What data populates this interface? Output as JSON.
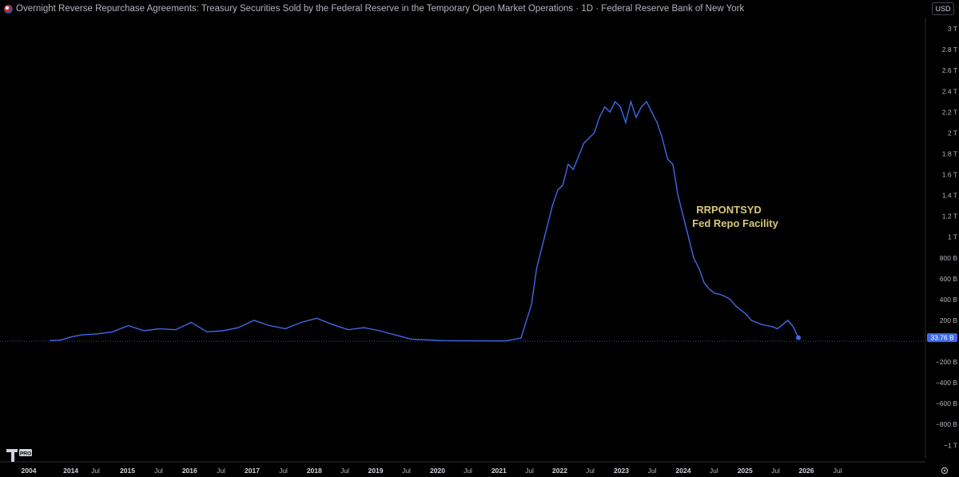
{
  "header": {
    "title": "Overnight Reverse Repurchase Agreements: Treasury Securities Sold by the Federal Reserve in the Temporary Open Market Operations · 1D · Federal Reserve Bank of New York",
    "currency_button": "USD"
  },
  "branding": {
    "logo_text": "PRO"
  },
  "colors": {
    "background": "#000000",
    "line": "#3f69ea",
    "annotation": "#d9c77a",
    "price_label_bg": "#3f69ea"
  },
  "chart_data": {
    "type": "line",
    "title": "Overnight Reverse Repurchase Agreements: Treasury Securities Sold by the Federal Reserve in the Temporary Open Market Operations · 1D · Federal Reserve Bank of New York",
    "series": [
      {
        "name": "RRPONTSYD",
        "x": [
          "2013-09",
          "2013-11",
          "2014-01",
          "2014-03",
          "2014-06",
          "2014-09",
          "2014-12",
          "2015-03",
          "2015-06",
          "2015-09",
          "2015-12",
          "2016-03",
          "2016-06",
          "2016-09",
          "2016-12",
          "2017-03",
          "2017-06",
          "2017-09",
          "2017-12",
          "2018-03",
          "2018-06",
          "2018-09",
          "2018-12",
          "2019-06",
          "2019-12",
          "2020-06",
          "2020-12",
          "2021-03",
          "2021-05",
          "2021-06",
          "2021-07",
          "2021-08",
          "2021-09",
          "2021-10",
          "2021-11",
          "2021-12",
          "2022-01",
          "2022-03",
          "2022-05",
          "2022-06",
          "2022-07",
          "2022-08",
          "2022-09",
          "2022-10",
          "2022-11",
          "2022-12",
          "2023-01",
          "2023-02",
          "2023-03",
          "2023-04",
          "2023-05",
          "2023-06",
          "2023-07",
          "2023-08",
          "2023-09",
          "2023-10",
          "2023-11",
          "2023-12",
          "2024-01",
          "2024-02",
          "2024-03",
          "2024-04",
          "2024-05",
          "2024-06",
          "2024-07",
          "2024-08",
          "2024-09",
          "2024-10",
          "2024-11",
          "2024-12",
          "2025-01",
          "2025-02",
          "2025-03",
          "2025-04",
          "2025-05",
          "2025-06",
          "2025-07",
          "2025-08"
        ],
        "values": [
          5,
          10,
          40,
          60,
          70,
          90,
          150,
          100,
          120,
          110,
          180,
          90,
          100,
          130,
          200,
          150,
          120,
          180,
          220,
          160,
          110,
          130,
          100,
          20,
          5,
          3,
          2,
          30,
          350,
          700,
          900,
          1100,
          1300,
          1450,
          1500,
          1700,
          1650,
          1900,
          2000,
          2150,
          2250,
          2200,
          2300,
          2250,
          2100,
          2300,
          2150,
          2250,
          2300,
          2200,
          2100,
          1950,
          1750,
          1700,
          1400,
          1200,
          1000,
          800,
          700,
          560,
          500,
          460,
          450,
          430,
          400,
          340,
          300,
          260,
          200,
          180,
          160,
          150,
          140,
          120,
          160,
          200,
          140,
          33.76
        ]
      }
    ],
    "y_ticks": [
      "3 T",
      "2.8 T",
      "2.6 T",
      "2.4 T",
      "2.2 T",
      "2 T",
      "1.8 T",
      "1.6 T",
      "1.4 T",
      "1.2 T",
      "1 T",
      "800 B",
      "600 B",
      "400 B",
      "200 B",
      "−200 B",
      "−400 B",
      "−600 B",
      "−800 B",
      "−1 T"
    ],
    "x_ticks": [
      "2004",
      "2014",
      "Jul",
      "2015",
      "Jul",
      "2016",
      "Jul",
      "2017",
      "Jul",
      "2018",
      "Jul",
      "2019",
      "Jul",
      "2020",
      "Jul",
      "2021",
      "Jul",
      "2022",
      "Jul",
      "2023",
      "Jul",
      "2024",
      "Jul",
      "2025",
      "Jul",
      "2026",
      "Jul"
    ],
    "x_year_ticks": [
      "2004",
      "2014",
      "2015",
      "2016",
      "2017",
      "2018",
      "2019",
      "2020",
      "2021",
      "2022",
      "2023",
      "2024",
      "2025",
      "2026"
    ],
    "ylim": [
      -1000,
      3000
    ],
    "unit": "billions USD",
    "last_value_label": "33.76 B",
    "annotations": [
      "RRPONTSYD",
      "Fed Repo Facility"
    ],
    "grid": false,
    "baseline": true
  }
}
